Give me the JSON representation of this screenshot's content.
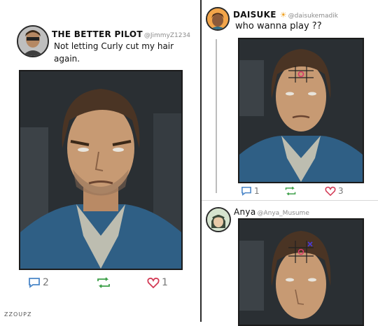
{
  "left_post": {
    "author": "THE BETTER PILOT",
    "handle": "@JimmyZ1234",
    "text_line1": "Not letting Curly cut my hair",
    "text_line2": "again.",
    "replies": "2",
    "likes": "1"
  },
  "right_post": {
    "author": "DAISUKE",
    "handle": "@daisukemadik",
    "text": "who wanna play ??",
    "replies": "1",
    "likes": "3"
  },
  "reply_post": {
    "author": "Anya",
    "handle": "@Anya_Musume"
  },
  "credit": "ZZOUPZ",
  "colors": {
    "reply_icon": "#4a86c8",
    "retweet_icon": "#3ea04a",
    "like_icon": "#d33a55",
    "sun_emoji": "#f0a020",
    "tic_circle": "#d83a6a",
    "tic_x": "#4a3ad8"
  }
}
